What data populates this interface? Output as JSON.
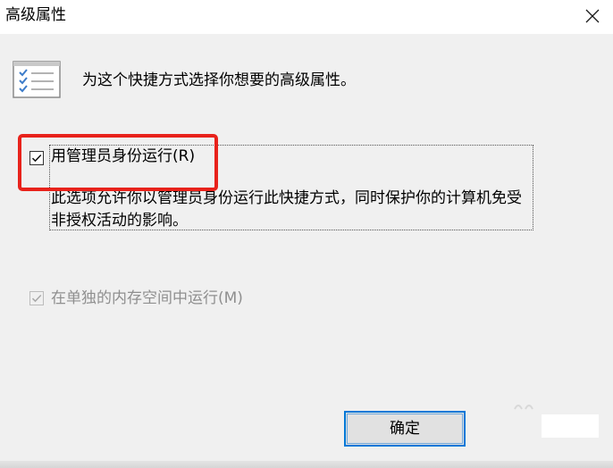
{
  "window": {
    "title": "高级属性",
    "close_glyph": "×"
  },
  "header": {
    "icon": "properties-list-icon",
    "text": "为这个快捷方式选择你想要的高级属性。"
  },
  "run_as_admin": {
    "label": "用管理员身份运行(R)",
    "checked": true,
    "highlight_color": "#e8221b",
    "description": "此选项允许你以管理员身份运行此快捷方式，同时保护你的计算机免受非授权活动的影响。"
  },
  "separate_memory": {
    "label": "在单独的内存空间中运行(M)",
    "checked": true,
    "enabled": false
  },
  "footer": {
    "ok_label": "确定",
    "accent": "#0078d7"
  }
}
